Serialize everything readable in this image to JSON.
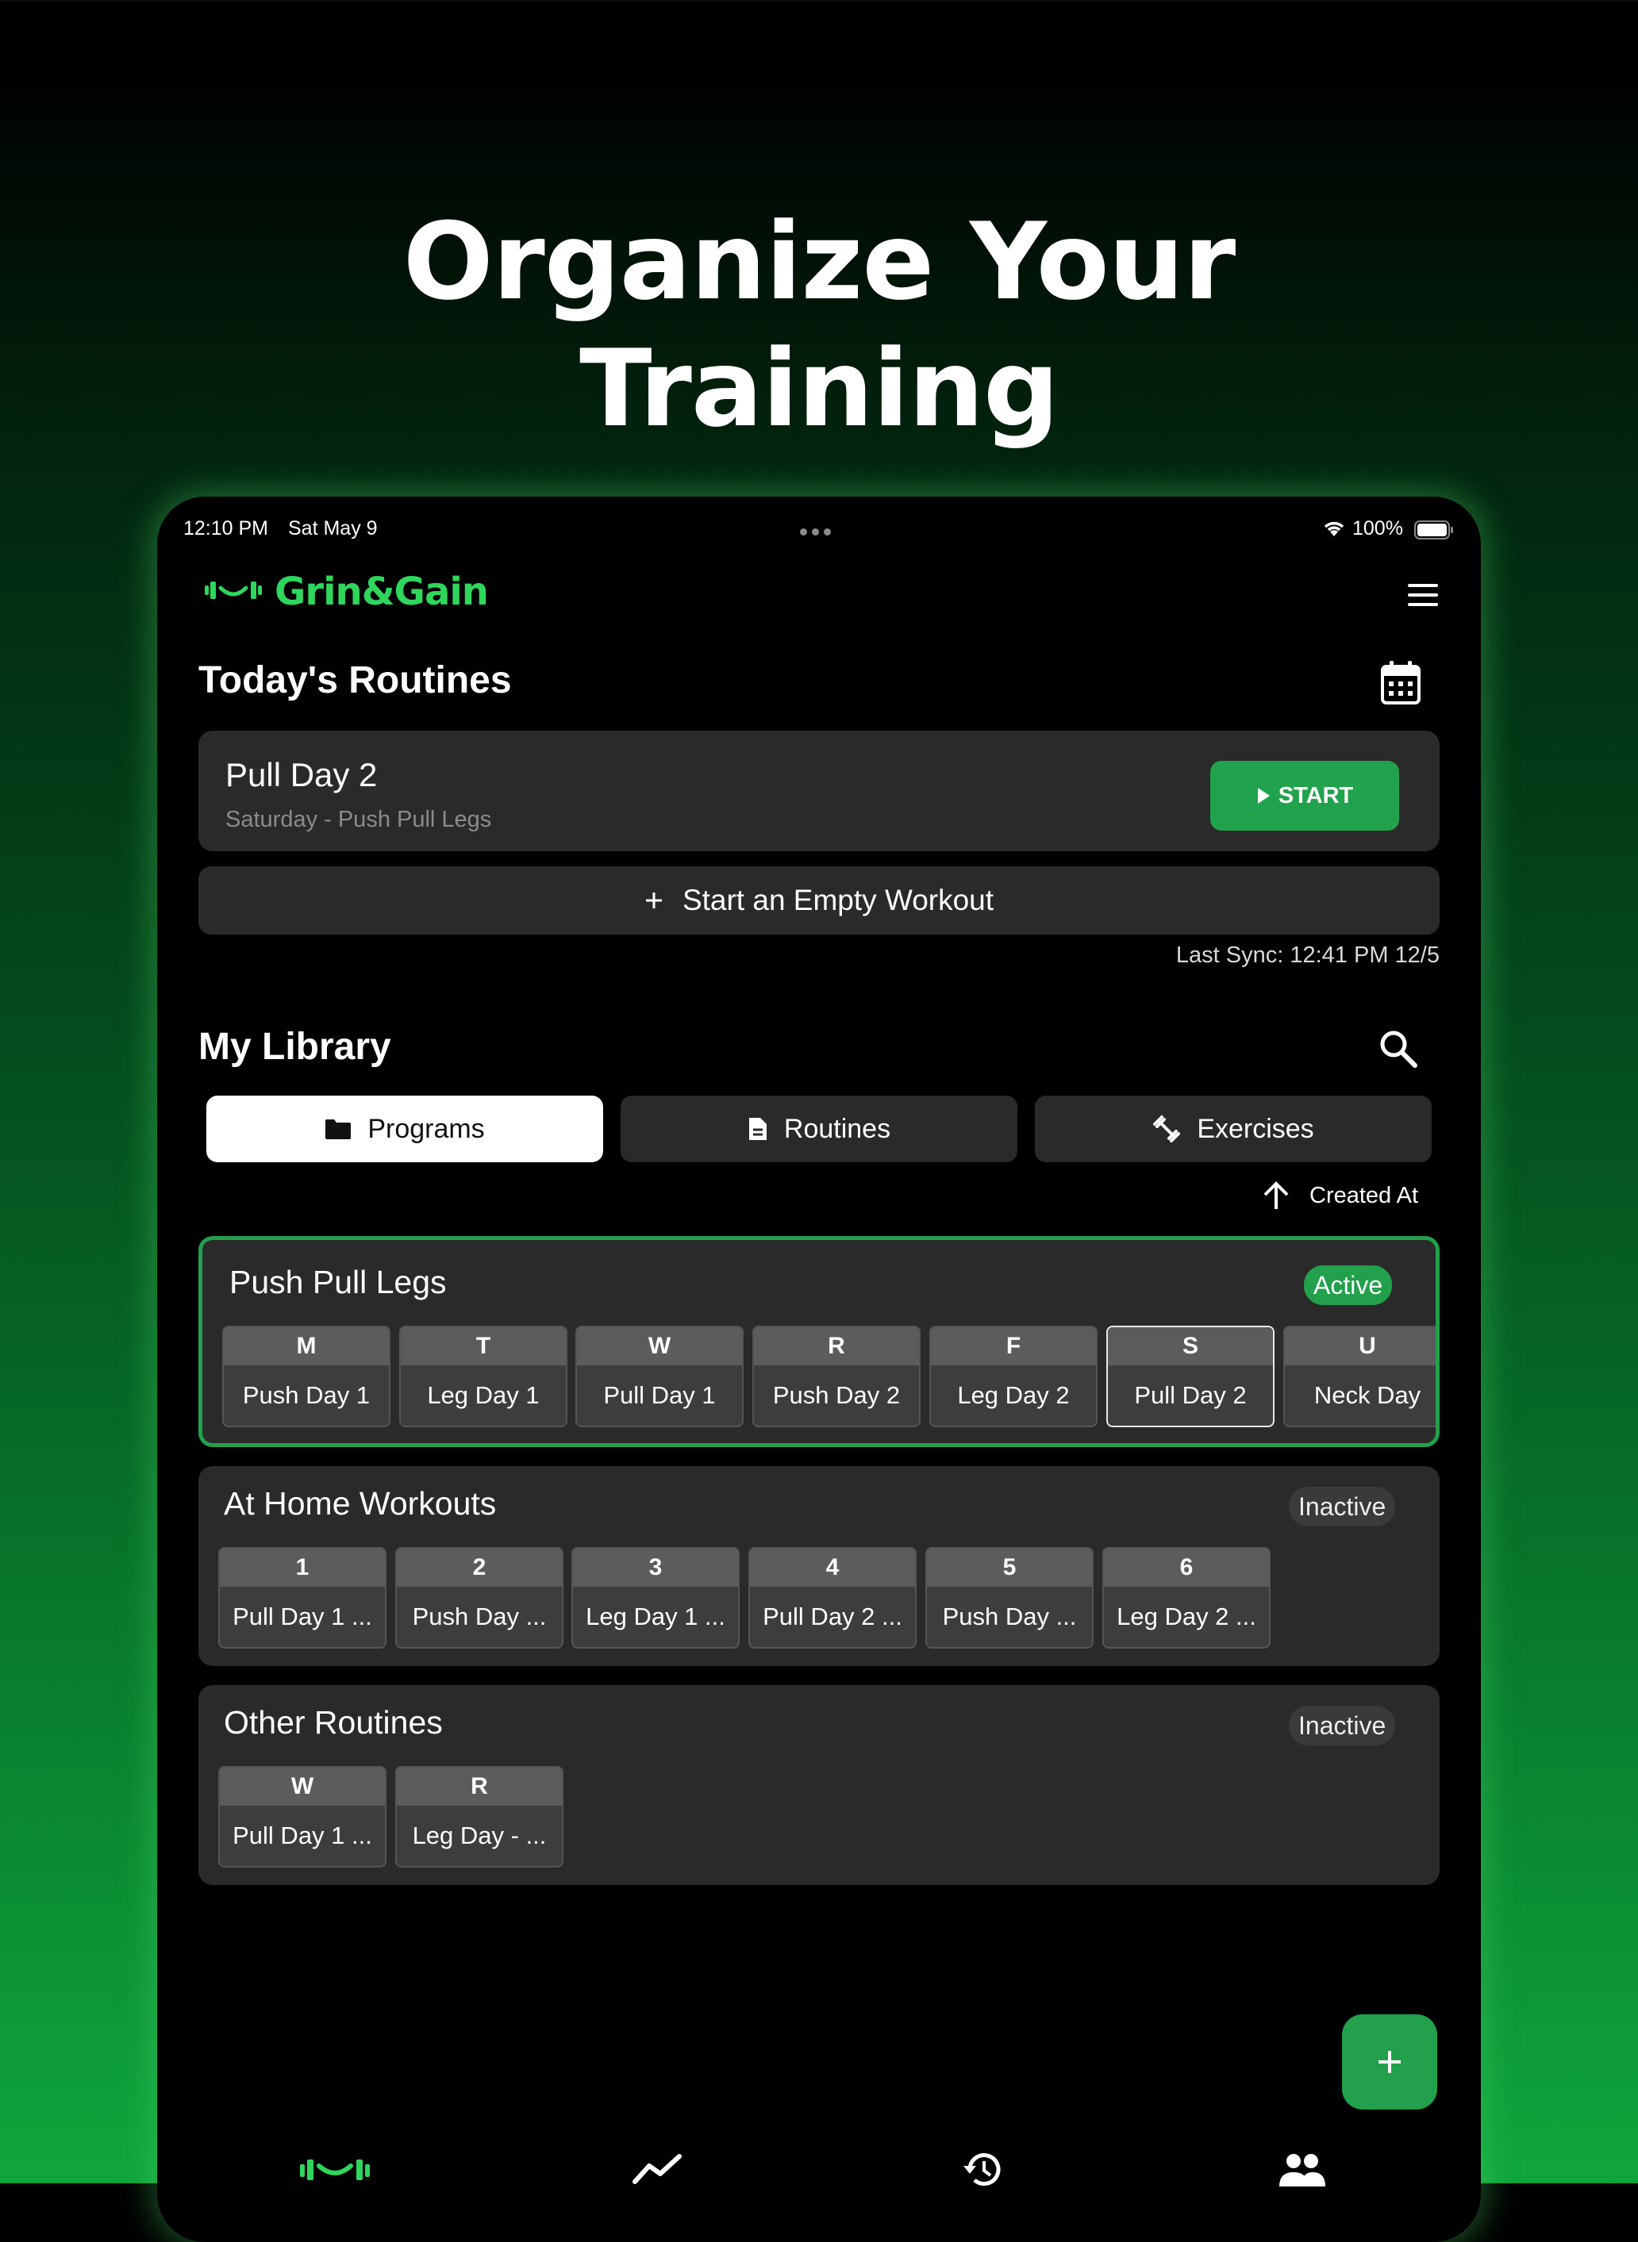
{
  "headline": {
    "line1": "Organize Your",
    "line2": "Training"
  },
  "status_bar": {
    "time": "12:10 PM",
    "date": "Sat May 9",
    "battery": "100%"
  },
  "app": {
    "name": "Grin&Gain",
    "brand_color": "#2fd65c"
  },
  "today": {
    "title": "Today's Routines",
    "routine": {
      "name": "Pull Day 2",
      "subtitle": "Saturday - Push Pull Legs"
    },
    "start_label": "START",
    "empty_workout_label": "Start an Empty Workout",
    "last_sync": "Last Sync: 12:41 PM 12/5"
  },
  "library": {
    "title": "My Library",
    "tabs": [
      {
        "label": "Programs",
        "icon": "folder-icon",
        "active": true
      },
      {
        "label": "Routines",
        "icon": "document-icon",
        "active": false
      },
      {
        "label": "Exercises",
        "icon": "dumbbell-icon",
        "active": false
      }
    ],
    "sort_label": "Created At",
    "programs": [
      {
        "name": "Push Pull Legs",
        "status": "Active",
        "days": [
          {
            "key": "M",
            "name": "Push Day 1"
          },
          {
            "key": "T",
            "name": "Leg Day 1"
          },
          {
            "key": "W",
            "name": "Pull Day 1"
          },
          {
            "key": "R",
            "name": "Push Day 2"
          },
          {
            "key": "F",
            "name": "Leg Day 2"
          },
          {
            "key": "S",
            "name": "Pull Day 2"
          },
          {
            "key": "U",
            "name": "Neck Day"
          }
        ]
      },
      {
        "name": "At Home Workouts",
        "status": "Inactive",
        "days": [
          {
            "key": "1",
            "name": "Pull Day 1 ..."
          },
          {
            "key": "2",
            "name": "Push Day ..."
          },
          {
            "key": "3",
            "name": "Leg Day 1 ..."
          },
          {
            "key": "4",
            "name": "Pull Day 2 ..."
          },
          {
            "key": "5",
            "name": "Push Day ..."
          },
          {
            "key": "6",
            "name": "Leg Day 2 ..."
          }
        ]
      },
      {
        "name": "Other Routines",
        "status": "Inactive",
        "days": [
          {
            "key": "W",
            "name": "Pull Day 1 ..."
          },
          {
            "key": "R",
            "name": "Leg Day - ..."
          }
        ]
      }
    ]
  },
  "bottom_nav": [
    "home-icon",
    "progress-icon",
    "history-icon",
    "community-icon"
  ],
  "colors": {
    "accent": "#22a04b",
    "card": "#2a2a2a",
    "background": "#000000"
  }
}
